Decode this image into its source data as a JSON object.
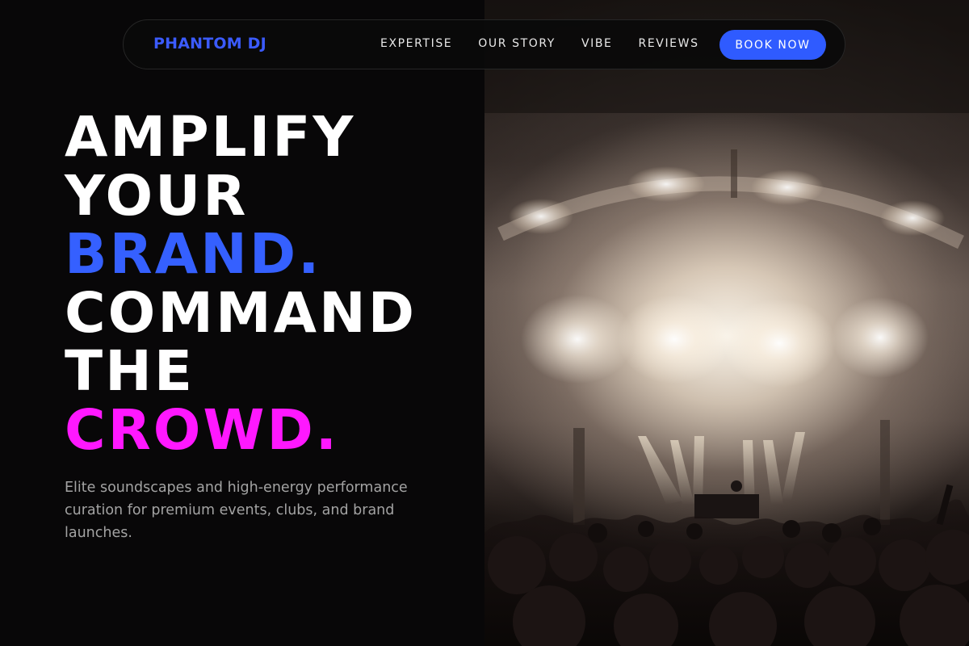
{
  "brand": {
    "name": "PHANTOM DJ",
    "accent_blue": "#3560ff",
    "accent_magenta": "#ff18ff"
  },
  "nav": {
    "links": [
      "EXPERTISE",
      "OUR STORY",
      "VIBE",
      "REVIEWS"
    ],
    "cta_label": "BOOK NOW"
  },
  "hero": {
    "headline": {
      "line1": "AMPLIFY",
      "line2": "YOUR",
      "line3": "BRAND.",
      "line4": "COMMAND",
      "line5": "THE",
      "line6": "CROWD."
    },
    "subtitle": "Elite soundscapes and high-energy performance curation for premium events, clubs, and brand launches.",
    "image": "concert-crowd-stage-lights-photo"
  }
}
